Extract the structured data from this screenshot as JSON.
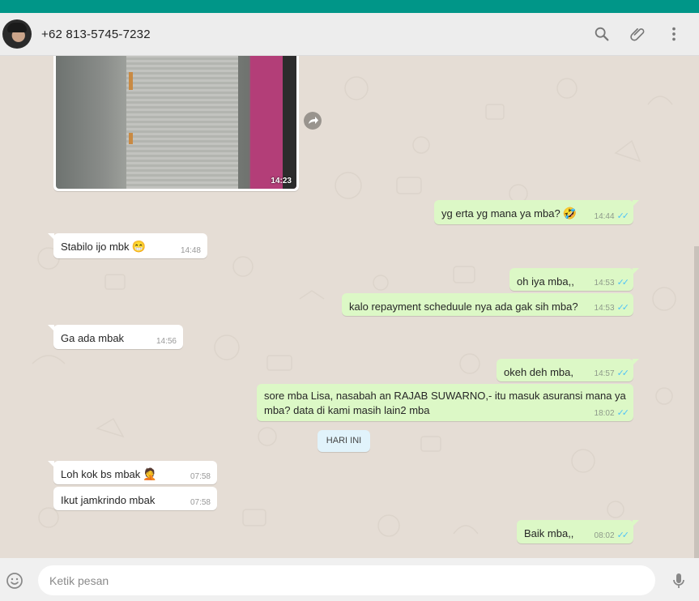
{
  "header": {
    "contact_name": "+62 813-5745-7232",
    "icons": [
      "avatar",
      "search-icon",
      "attach-icon",
      "menu-icon"
    ]
  },
  "media": {
    "time": "14:23",
    "forward_icon": "forward-icon"
  },
  "messages": [
    {
      "dir": "out",
      "text": "yg erta yg mana ya mba?",
      "emoji": "🤣",
      "time": "14:44",
      "status": "read"
    },
    {
      "dir": "in",
      "text": "Stabilo ijo mbk",
      "emoji": "😁",
      "time": "14:48"
    },
    {
      "dir": "out",
      "text": "oh iya mba,,",
      "time": "14:53",
      "status": "read"
    },
    {
      "dir": "out",
      "text": "kalo repayment scheduule nya ada gak sih mba?",
      "time": "14:53",
      "status": "read"
    },
    {
      "dir": "in",
      "text": "Ga ada mbak",
      "time": "14:56"
    },
    {
      "dir": "out",
      "text": "okeh deh mba,",
      "time": "14:57",
      "status": "read"
    },
    {
      "dir": "out",
      "text_line1": "sore mba Lisa, nasabah an RAJAB SUWARNO,- itu masuk asuransi mana ya",
      "text_line2": "mba? data di kami masih lain2 mba",
      "time": "18:02",
      "status": "read"
    },
    {
      "dir": "in",
      "text": "Loh kok bs mbak",
      "emoji": "🤦",
      "time": "07:58"
    },
    {
      "dir": "in",
      "text": "Ikut jamkrindo mbak",
      "time": "07:58"
    },
    {
      "dir": "out",
      "text": "Baik mba,,",
      "time": "08:02",
      "status": "read"
    }
  ],
  "day_chip": "HARI INI",
  "ticks": "✓✓",
  "footer": {
    "placeholder": "Ketik pesan",
    "emoji_icon": "smiley-icon",
    "mic_icon": "microphone-icon"
  },
  "colors": {
    "top_band": "#009688",
    "outgoing_bubble": "#dcf8c6",
    "incoming_bubble": "#ffffff",
    "read_tick": "#4fc3f7",
    "chat_background": "#e5ddd5"
  }
}
